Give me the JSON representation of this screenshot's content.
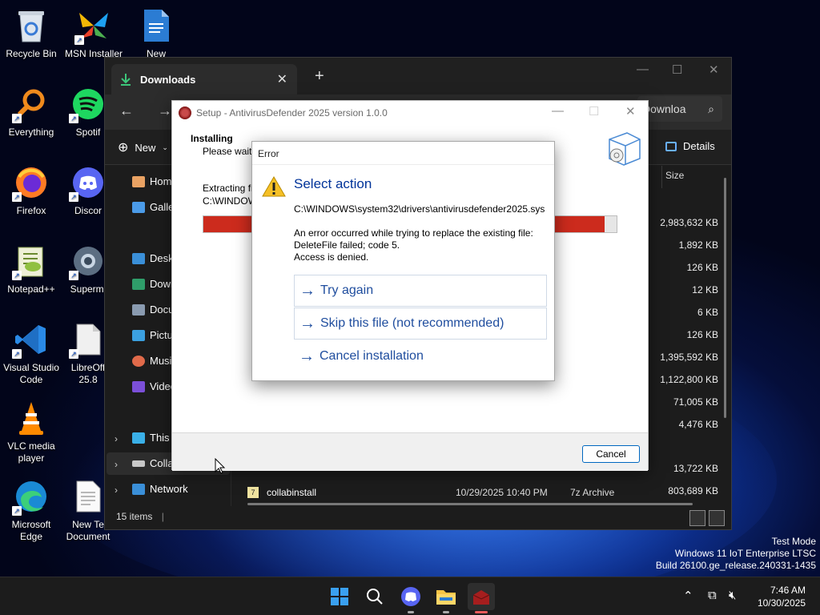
{
  "desktop": {
    "icons": [
      {
        "label": "Recycle Bin"
      },
      {
        "label": "MSN Installer"
      },
      {
        "label": "New"
      },
      {
        "label": "Everything"
      },
      {
        "label": "Spotif"
      },
      {
        "label": "Firefox"
      },
      {
        "label": "Discor"
      },
      {
        "label": "Notepad++"
      },
      {
        "label": "Supermi"
      },
      {
        "label": "Visual Studio Code"
      },
      {
        "label": "LibreOff 25.8"
      },
      {
        "label": "VLC media player"
      },
      {
        "label": "Microsoft Edge"
      },
      {
        "label": "New Te Document"
      }
    ]
  },
  "explorer": {
    "tab_title": "Downloads",
    "search_text": "Downloa",
    "new_label": "New",
    "details_label": "Details",
    "size_header": "Size",
    "sidebar": [
      {
        "label": "Home"
      },
      {
        "label": "Galler"
      },
      {
        "label": "Deskt"
      },
      {
        "label": "Down"
      },
      {
        "label": "Docu"
      },
      {
        "label": "Pictu"
      },
      {
        "label": "Music"
      },
      {
        "label": "Video"
      },
      {
        "label": "This P"
      },
      {
        "label": "Colla"
      },
      {
        "label": "Network"
      }
    ],
    "sizes": [
      "2,983,632 KB",
      "1,892 KB",
      "126 KB",
      "12 KB",
      "6 KB",
      "126 KB",
      "1,395,592 KB",
      "1,122,800 KB",
      "71,005 KB",
      "4,476 KB",
      "13,722 KB",
      "803,689 KB"
    ],
    "last_row": {
      "name": "collabinstall",
      "date": "10/29/2025 10:40 PM",
      "type": "7z Archive",
      "size": "803,689 KB"
    },
    "status": "15 items"
  },
  "setup": {
    "title": "Setup - AntivirusDefender 2025 version 1.0.0",
    "heading": "Installing",
    "subheading": "Please wait w",
    "extract_line1": "Extracting fil",
    "extract_line2": "C:\\WINDOW",
    "progress": 0.97,
    "cancel_label": "Cancel"
  },
  "error": {
    "title": "Error",
    "heading": "Select action",
    "path": "C:\\WINDOWS\\system32\\drivers\\antivirusdefender2025.sys",
    "msg1": "An error occurred while trying to replace the existing file:",
    "msg2": "DeleteFile failed; code 5.",
    "msg3": "Access is denied.",
    "actions": [
      "Try again",
      "Skip this file (not recommended)",
      "Cancel installation"
    ]
  },
  "system": {
    "test_mode": "Test Mode",
    "os": "Windows 11 IoT Enterprise LTSC",
    "build": "Build 26100.ge_release.240331-1435",
    "time": "7:46 AM",
    "date": "10/30/2025"
  },
  "colors": {
    "progress_fill": "#cc2b1d",
    "link_blue": "#1f4d9e"
  }
}
